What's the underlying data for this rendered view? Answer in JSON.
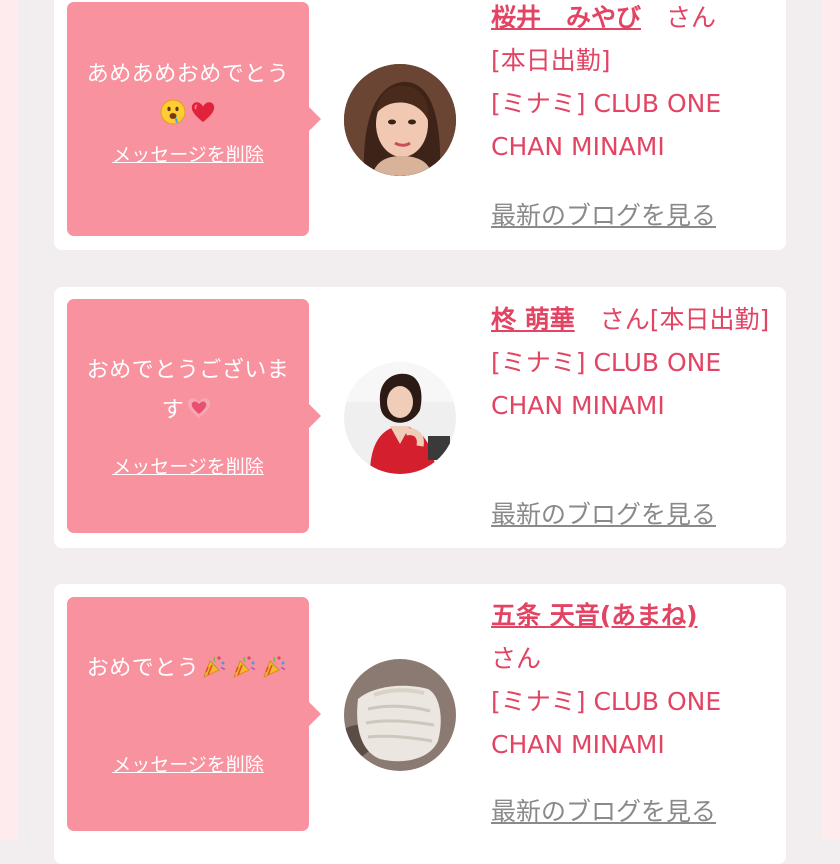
{
  "colors": {
    "bubble": "#f8929f",
    "accent": "#e24464",
    "link_gray": "#8a8a8a",
    "page_bg": "#f2eeef",
    "edge_pink": "#fdebee"
  },
  "cards": [
    {
      "message_text": "あめあめおめでとう",
      "message_emojis": [
        "drooling-face-emoji",
        "red-heart-emoji"
      ],
      "delete_label": "メッセージを削除",
      "avatar_icon": "woman-selfie-avatar",
      "name": "桜井　みやび",
      "suffix": "さん",
      "status": "[本日出勤]",
      "shop_area": "[ミナミ]",
      "shop_name": "CLUB ONE CHAN MINAMI",
      "blog_label": "最新のブログを見る"
    },
    {
      "message_text": "おめでとうございます",
      "message_emojis": [
        "growing-heart-emoji"
      ],
      "delete_label": "メッセージを削除",
      "avatar_icon": "woman-red-dress-avatar",
      "name": "柊 萌華",
      "suffix": "さん",
      "status": "[本日出勤]",
      "shop_area": "[ミナミ]",
      "shop_name": "CLUB ONE CHAN MINAMI",
      "blog_label": "最新のブログを見る"
    },
    {
      "message_text": "おめでとう",
      "message_emojis": [
        "party-popper-emoji",
        "party-popper-emoji",
        "party-popper-emoji"
      ],
      "delete_label": "メッセージを削除",
      "avatar_icon": "white-dress-avatar",
      "name": "五条 天音(あまね)",
      "suffix": "さん",
      "status": "",
      "shop_area": "[ミナミ]",
      "shop_name": "CLUB ONE CHAN MINAMI",
      "blog_label": "最新のブログを見る"
    }
  ]
}
